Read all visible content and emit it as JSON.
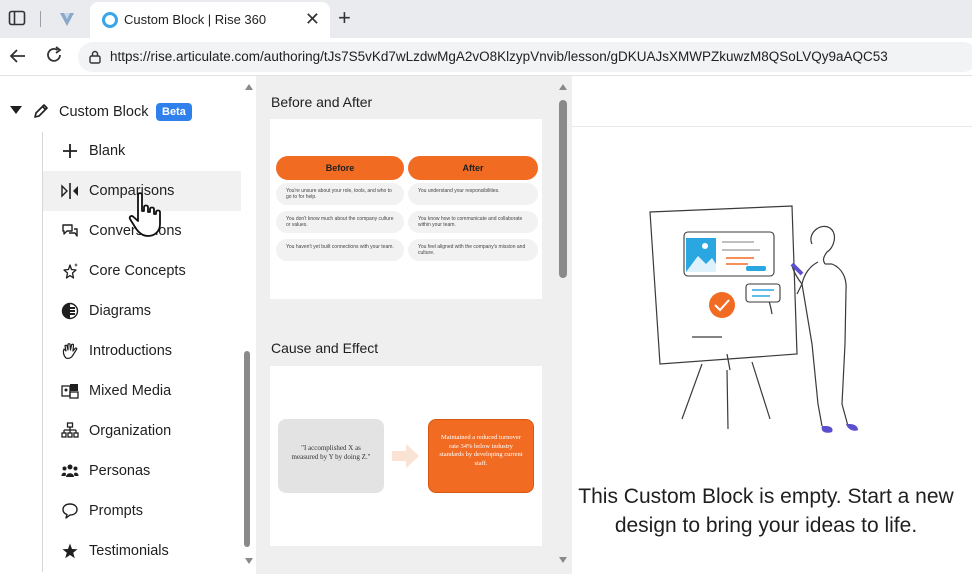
{
  "browser": {
    "tab_title": "Custom Block | Rise 360",
    "tab_close": "✕",
    "new_tab": "+",
    "url": "https://rise.articulate.com/authoring/tJs7S5vKd7wLzdwMgA2vO8KlzypVnvib/lesson/gDKUAJsXMWPZkuwzM8QSoLVQy9aAQC53"
  },
  "sidebar": {
    "group_label": "Custom Block",
    "beta_badge": "Beta",
    "items": [
      {
        "label": "Blank",
        "icon": "plus-icon"
      },
      {
        "label": "Comparisons",
        "icon": "comparison-icon"
      },
      {
        "label": "Conversations",
        "icon": "chat-bubbles-icon"
      },
      {
        "label": "Core Concepts",
        "icon": "sparkle-star-icon"
      },
      {
        "label": "Diagrams",
        "icon": "diagram-icon"
      },
      {
        "label": "Introductions",
        "icon": "hand-wave-icon"
      },
      {
        "label": "Mixed Media",
        "icon": "mixed-media-icon"
      },
      {
        "label": "Organization",
        "icon": "org-chart-icon"
      },
      {
        "label": "Personas",
        "icon": "people-icon"
      },
      {
        "label": "Prompts",
        "icon": "speech-bubble-icon"
      },
      {
        "label": "Testimonials",
        "icon": "star-icon"
      }
    ]
  },
  "templates": {
    "before_after": {
      "title": "Before and After",
      "before_label": "Before",
      "after_label": "After",
      "rows": [
        {
          "before": "You're unsure about your role, tools, and who to go to for help.",
          "after": "You understand your responsibilities."
        },
        {
          "before": "You don't know much about the company culture or values.",
          "after": "You know how to communicate and collaborate within your team."
        },
        {
          "before": "You haven't yet built connections with your team.",
          "after": "You feel aligned with the company's mission and culture."
        }
      ]
    },
    "cause_effect": {
      "title": "Cause and Effect",
      "cause": "\"I accomplished X as measured by Y by doing Z.\"",
      "effect": "Maintained a reduced turnover rate 34% below industry standards by developing current staff."
    }
  },
  "canvas": {
    "empty_message": "This Custom Block is empty. Start a new\ndesign to bring your ideas to life."
  },
  "colors": {
    "accent_orange": "#f26b22",
    "beta_blue": "#2f80ed",
    "illustration_blue": "#2aa7e0",
    "illustration_purple": "#5a4fcf"
  }
}
